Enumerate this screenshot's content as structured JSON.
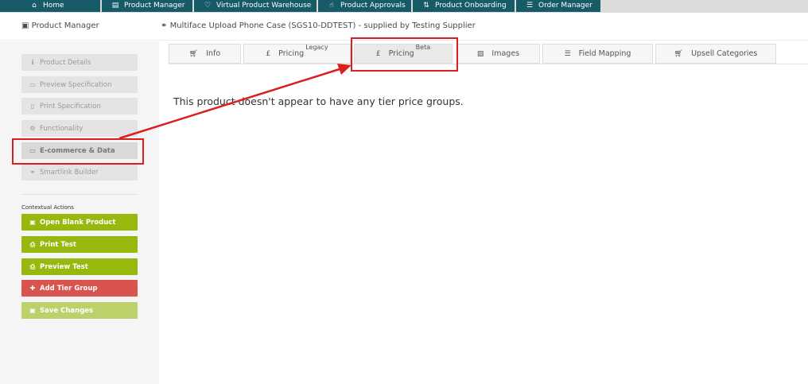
{
  "topnav": {
    "items": [
      {
        "label": "Home",
        "icon": "home-icon"
      },
      {
        "label": "Product Manager",
        "icon": "document-icon"
      },
      {
        "label": "Virtual Product Warehouse",
        "icon": "heart-icon"
      },
      {
        "label": "Product Approvals",
        "icon": "thumbs-up-icon"
      },
      {
        "label": "Product Onboarding",
        "icon": "transfer-icon"
      },
      {
        "label": "Order Manager",
        "icon": "list-icon"
      }
    ]
  },
  "header": {
    "section_title": "Product Manager",
    "product_title": "Multiface Upload Phone Case (SGS10-DDTEST) - supplied by Testing Supplier"
  },
  "sidebar": {
    "items": [
      {
        "label": "Product Details",
        "icon": "info-icon"
      },
      {
        "label": "Preview Specification",
        "icon": "monitor-icon"
      },
      {
        "label": "Print Specification",
        "icon": "file-icon"
      },
      {
        "label": "Functionality",
        "icon": "cogs-icon"
      },
      {
        "label": "E-commerce & Data",
        "icon": "credit-card-icon"
      },
      {
        "label": "Smartlink Builder",
        "icon": "link-icon"
      }
    ],
    "context_label": "Contextual Actions",
    "actions": [
      {
        "label": "Open Blank Product",
        "icon": "square-icon"
      },
      {
        "label": "Print Test",
        "icon": "print-icon"
      },
      {
        "label": "Preview Test",
        "icon": "print-icon"
      },
      {
        "label": "Add Tier Group",
        "icon": "plus-icon"
      },
      {
        "label": "Save Changes",
        "icon": "save-icon"
      }
    ]
  },
  "tabs": [
    {
      "label": "Info",
      "sup": "",
      "icon": "cart-icon"
    },
    {
      "label": "Pricing",
      "sup": "Legacy",
      "icon": "pound-icon"
    },
    {
      "label": "Pricing",
      "sup": "Beta",
      "icon": "pound-icon"
    },
    {
      "label": "Images",
      "sup": "",
      "icon": "image-icon"
    },
    {
      "label": "Field Mapping",
      "sup": "",
      "icon": "list-icon"
    },
    {
      "label": "Upsell Categories",
      "sup": "",
      "icon": "cart-icon"
    }
  ],
  "main": {
    "message": "This product doesn't appear to have any tier price groups."
  },
  "colors": {
    "nav_bg": "#175a68",
    "green_action": "#97b80d",
    "red_action": "#d9534f",
    "annotation": "#dc1e1e"
  }
}
